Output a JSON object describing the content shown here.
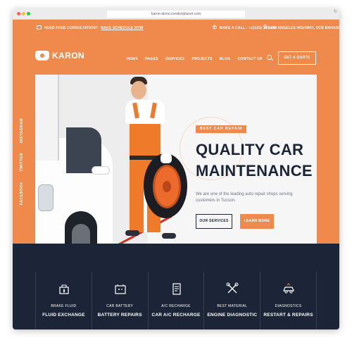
{
  "browser": {
    "url": "karon-demo.creativeplanet.com"
  },
  "topbar": {
    "consult_text": "NEED FREE CONSULTATION?",
    "consult_link": "MAKE SCHEDULE NOW",
    "call": "MAKE A CALL : +1(123) 345 699",
    "address": "LOS ANGELES HIGHWAY, SCB BAHASI"
  },
  "nav": {
    "logo": "KARON",
    "links": [
      "HOME",
      "PAGES",
      "SERVICES",
      "PROJECTS",
      "BLOG",
      "CONTACT US"
    ],
    "quote_button": "GET A QUOTE"
  },
  "social": [
    "INSTAGRAM",
    "TWITTER",
    "FACEBOOK"
  ],
  "hero": {
    "tag": "BEST CAR REPAIR",
    "headline": "QUALITY CAR MAINTENANCE",
    "description": "We are one of the leading auto repair shops serving customers in Tucson.",
    "btn_services": "OUR SERVICES",
    "btn_learn": "LEARN MORE"
  },
  "services": [
    {
      "icon": "brake-fluid-icon",
      "sub": "BRAKE FLUID",
      "title": "FLUID EXCHANGE"
    },
    {
      "icon": "car-battery-icon",
      "sub": "CAR BATTERY",
      "title": "BATTERY REPAIRS"
    },
    {
      "icon": "ac-recharge-icon",
      "sub": "A/C RECHARGE",
      "title": "CAR A/C RECHARGE"
    },
    {
      "icon": "engine-diagnostic-icon",
      "sub": "BEST MATERIAL",
      "title": "ENGINE DIAGNOSTIC"
    },
    {
      "icon": "diagnostics-icon",
      "sub": "DIAGNOSTICS",
      "title": "RESTART & REPAIRS"
    }
  ],
  "colors": {
    "brand_orange": "#ef8a4c",
    "navy": "#1b2537",
    "headline": "#1c2438"
  }
}
